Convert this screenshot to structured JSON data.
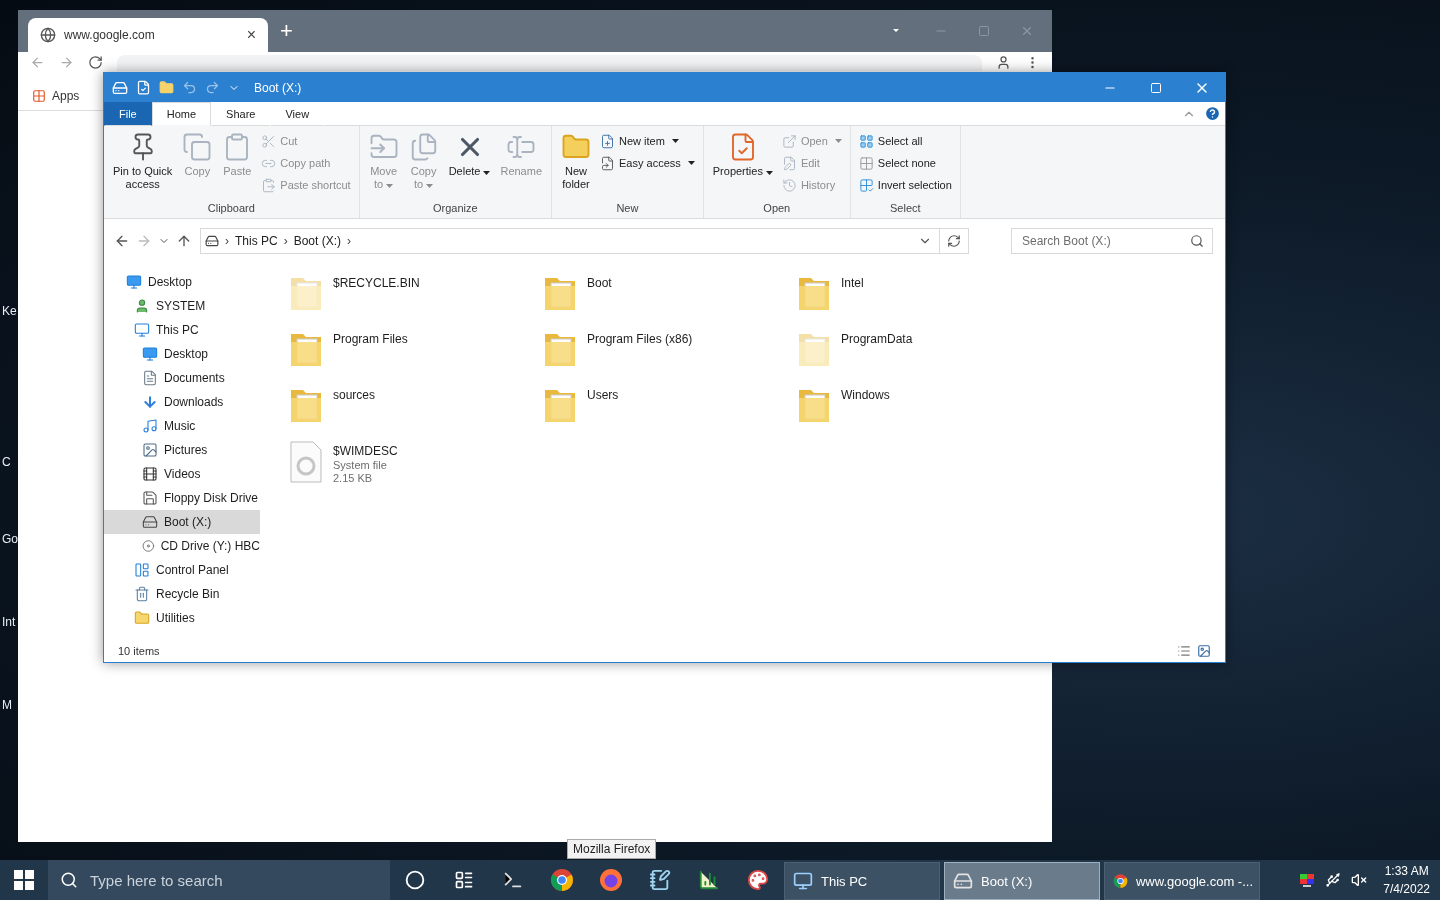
{
  "desktop_labels": [
    "Ke",
    "C",
    "Go",
    "Int",
    "M"
  ],
  "browser": {
    "tab": {
      "title": "www.google.com",
      "close": "×"
    },
    "new_tab": "+",
    "bookmarks": [
      {
        "label": "Apps"
      }
    ]
  },
  "explorer": {
    "title": "Boot (X:)",
    "tabs": [
      {
        "label": "File",
        "kind": "file",
        "selected": false
      },
      {
        "label": "Home",
        "kind": "tab",
        "selected": true
      },
      {
        "label": "Share",
        "kind": "tab",
        "selected": false
      },
      {
        "label": "View",
        "kind": "tab",
        "selected": false
      }
    ],
    "ribbon": [
      {
        "label": "Clipboard",
        "large": [
          {
            "kind": "pin",
            "label": "Pin to Quick\naccess",
            "disabled": false,
            "menu": false
          },
          {
            "kind": "copy",
            "label": "Copy",
            "disabled": true,
            "menu": false
          },
          {
            "kind": "paste",
            "label": "Paste",
            "disabled": true,
            "menu": false
          }
        ],
        "small": [
          {
            "kind": "cut",
            "label": "Cut",
            "disabled": true,
            "menu": false
          },
          {
            "kind": "copy_path",
            "label": "Copy path",
            "disabled": true,
            "menu": false
          },
          {
            "kind": "paste_shortcut",
            "label": "Paste shortcut",
            "disabled": true,
            "menu": false
          }
        ]
      },
      {
        "label": "Organize",
        "large": [
          {
            "kind": "move",
            "label": "Move\nto",
            "disabled": true,
            "menu": true
          },
          {
            "kind": "copy_to",
            "label": "Copy\nto",
            "disabled": true,
            "menu": true
          },
          {
            "kind": "delete",
            "label": "Delete",
            "disabled": false,
            "menu": true
          },
          {
            "kind": "rename",
            "label": "Rename",
            "disabled": true,
            "menu": false
          }
        ]
      },
      {
        "label": "New",
        "large": [
          {
            "kind": "new_folder",
            "label": "New\nfolder",
            "disabled": false,
            "menu": false
          }
        ],
        "small": [
          {
            "kind": "new_item",
            "label": "New item",
            "disabled": false,
            "menu": true
          },
          {
            "kind": "easy_access",
            "label": "Easy access",
            "disabled": false,
            "menu": true
          }
        ]
      },
      {
        "label": "Open",
        "large": [
          {
            "kind": "properties",
            "label": "Properties",
            "disabled": false,
            "menu": true
          }
        ],
        "small": [
          {
            "kind": "open",
            "label": "Open",
            "disabled": true,
            "menu": true
          },
          {
            "kind": "edit",
            "label": "Edit",
            "disabled": true,
            "menu": false
          },
          {
            "kind": "history",
            "label": "History",
            "disabled": true,
            "menu": false
          }
        ]
      },
      {
        "label": "Select",
        "small": [
          {
            "kind": "select_all",
            "label": "Select all",
            "disabled": false,
            "menu": false
          },
          {
            "kind": "select_none",
            "label": "Select none",
            "disabled": false,
            "menu": false
          },
          {
            "kind": "invert",
            "label": "Invert selection",
            "disabled": false,
            "menu": false
          }
        ]
      }
    ],
    "breadcrumb": [
      "This PC",
      "Boot (X:)"
    ],
    "breadcrumb_separator": "›",
    "search": {
      "placeholder": "Search Boot (X:)"
    },
    "nav": [
      {
        "label": "Desktop",
        "kind": "desktop",
        "selected": false,
        "children": [
          {
            "label": "SYSTEM",
            "kind": "user",
            "selected": false
          },
          {
            "label": "This PC",
            "kind": "pc",
            "selected": false,
            "children": [
              {
                "label": "Desktop",
                "kind": "desktop",
                "selected": false
              },
              {
                "label": "Documents",
                "kind": "documents",
                "selected": false
              },
              {
                "label": "Downloads",
                "kind": "downloads",
                "selected": false
              },
              {
                "label": "Music",
                "kind": "music",
                "selected": false
              },
              {
                "label": "Pictures",
                "kind": "pictures",
                "selected": false
              },
              {
                "label": "Videos",
                "kind": "videos",
                "selected": false
              },
              {
                "label": "Floppy Disk Drive",
                "kind": "floppy",
                "selected": false
              },
              {
                "label": "Boot (X:)",
                "kind": "drive",
                "selected": true
              },
              {
                "label": "CD Drive (Y:) HBC",
                "kind": "cd",
                "selected": false
              }
            ]
          },
          {
            "label": "Control Panel",
            "kind": "control",
            "selected": false
          },
          {
            "label": "Recycle Bin",
            "kind": "recycle",
            "selected": false
          },
          {
            "label": "Utilities",
            "kind": "folder",
            "selected": false
          }
        ]
      }
    ],
    "files": [
      {
        "name": "$RECYCLE.BIN",
        "kind": "folder",
        "hidden": true
      },
      {
        "name": "Boot",
        "kind": "folder",
        "hidden": false
      },
      {
        "name": "Intel",
        "kind": "folder",
        "hidden": false
      },
      {
        "name": "Program Files",
        "kind": "folder",
        "hidden": false
      },
      {
        "name": "Program Files (x86)",
        "kind": "folder",
        "hidden": false
      },
      {
        "name": "ProgramData",
        "kind": "folder",
        "hidden": true
      },
      {
        "name": "sources",
        "kind": "folder",
        "hidden": false
      },
      {
        "name": "Users",
        "kind": "folder",
        "hidden": false
      },
      {
        "name": "Windows",
        "kind": "folder",
        "hidden": false
      },
      {
        "name": "$WIMDESC",
        "kind": "file",
        "hidden": false,
        "type": "System file",
        "size": "2.15 KB"
      }
    ],
    "status": "10 items"
  },
  "taskbar": {
    "search_placeholder": "Type here to search",
    "windows": [
      {
        "label": "This PC",
        "kind": "pc",
        "selected": false
      },
      {
        "label": "Boot (X:)",
        "kind": "drive",
        "selected": true
      },
      {
        "label": "www.google.com -...",
        "kind": "chrome",
        "selected": false
      }
    ],
    "time": "1:33 AM",
    "date": "7/4/2022",
    "tooltip": "Mozilla Firefox"
  }
}
